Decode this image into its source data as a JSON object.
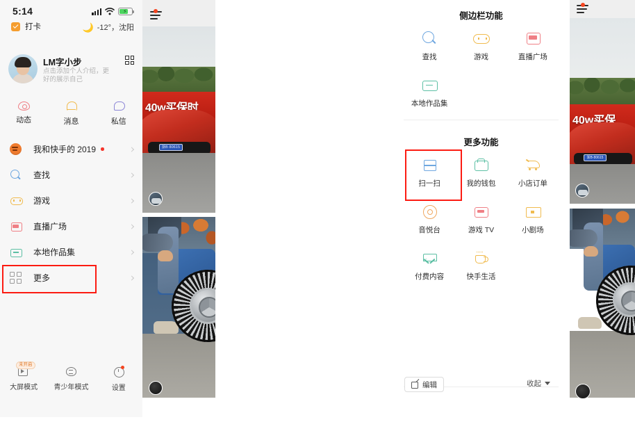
{
  "colors": {
    "highlight": "#fc1b12",
    "panel_bg": "#f7f7f7",
    "blue": "#6fa7e0",
    "green": "#5cbfa4",
    "yellow": "#f0bb4f",
    "pink": "#ef7f85",
    "purple": "#8b85d6",
    "orange": "#ef7b2e",
    "battery_green": "#4cd55f"
  },
  "left_phone": {
    "status_bar": {
      "time": "5:14",
      "signal_icon": "signal-bars-icon",
      "wifi_icon": "wifi-icon",
      "battery_icon": "battery-charging-icon"
    },
    "checkin": {
      "icon": "checkbox-icon",
      "label": "打卡"
    },
    "weather": {
      "icon": "moon-icon",
      "text": "-12°，沈阳"
    },
    "profile": {
      "avatar": "user-avatar",
      "name": "LM字小步",
      "description": "点击添加个人介绍，更好的展示自己",
      "qr_icon": "qr-code-icon"
    },
    "actions": [
      {
        "label": "动态",
        "icon": "eye-icon"
      },
      {
        "label": "消息",
        "icon": "bell-icon"
      },
      {
        "label": "私信",
        "icon": "chat-bubble-icon"
      }
    ],
    "menu": [
      {
        "label": "我和快手的 2019",
        "icon": "pumpkin-icon",
        "dot": true
      },
      {
        "label": "查找",
        "icon": "search-icon",
        "dot": false
      },
      {
        "label": "游戏",
        "icon": "game-icon",
        "dot": false
      },
      {
        "label": "直播广场",
        "icon": "live-icon",
        "dot": false
      },
      {
        "label": "本地作品集",
        "icon": "folder-icon",
        "dot": false
      },
      {
        "label": "更多",
        "icon": "grid-icon",
        "dot": false
      }
    ],
    "bottom": [
      {
        "label": "大屏模式",
        "icon": "big-screen-icon",
        "badge": "未开启"
      },
      {
        "label": "青少年模式",
        "icon": "teen-mode-icon",
        "badge": ""
      },
      {
        "label": "设置",
        "icon": "settings-icon",
        "badge": ""
      }
    ],
    "video": {
      "menu_icon": "hamburger-menu-icon",
      "banner_text": "40w买保时",
      "plate_text": "浙B·80615"
    }
  },
  "right_phone": {
    "section_one": {
      "title": "侧边栏功能",
      "items": [
        {
          "label": "查找",
          "icon": "search-icon"
        },
        {
          "label": "游戏",
          "icon": "game-icon"
        },
        {
          "label": "直播广场",
          "icon": "live-icon"
        },
        {
          "label": "本地作品集",
          "icon": "folder-icon"
        }
      ]
    },
    "section_two": {
      "title": "更多功能",
      "items": [
        {
          "label": "扫一扫",
          "icon": "scan-icon"
        },
        {
          "label": "我的钱包",
          "icon": "wallet-icon"
        },
        {
          "label": "小店订单",
          "icon": "cart-icon"
        },
        {
          "label": "音悦台",
          "icon": "music-disc-icon"
        },
        {
          "label": "游戏 TV",
          "icon": "game-tv-icon"
        },
        {
          "label": "小剧场",
          "icon": "tv-icon"
        },
        {
          "label": "付费内容",
          "icon": "diamond-icon"
        },
        {
          "label": "快手生活",
          "icon": "coffee-cup-icon"
        }
      ]
    },
    "bottom_bar": {
      "edit_label": "编辑",
      "edit_icon": "pencil-edit-icon",
      "collapse_label": "收起",
      "collapse_icon": "caret-down-icon"
    },
    "video": {
      "menu_icon": "hamburger-menu-icon",
      "banner_text": "40w买保",
      "plate_text": "浙B·80615"
    }
  }
}
